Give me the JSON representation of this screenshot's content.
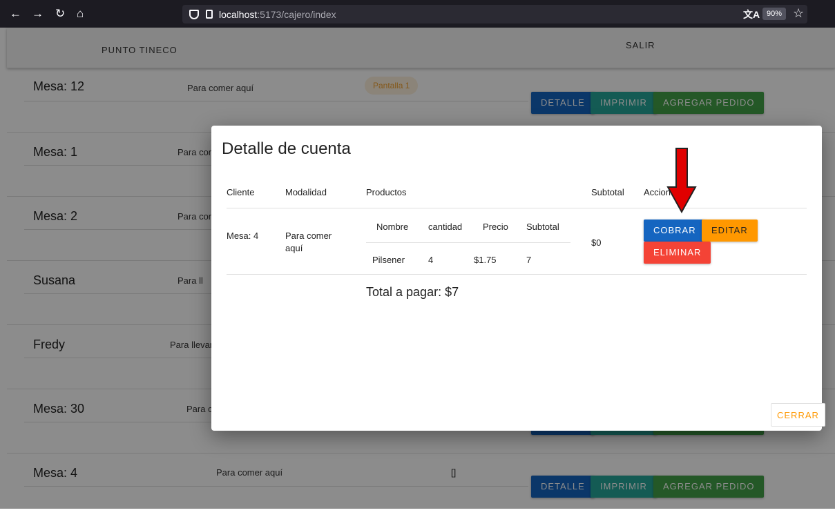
{
  "browser": {
    "url_host": "localhost",
    "url_path": ":5173/cajero/index",
    "zoom": "90%"
  },
  "header": {
    "brand": "PUNTO TINECO",
    "logout": "SALIR"
  },
  "orders": [
    {
      "mesa": "Mesa: 12",
      "modalidad": "Para comer aquí",
      "chip": "Pantalla 1"
    },
    {
      "mesa": "Mesa: 1",
      "modalidad": "Para com"
    },
    {
      "mesa": "Mesa: 2",
      "modalidad": "Para com"
    },
    {
      "mesa": "Susana",
      "modalidad": "Para ll"
    },
    {
      "mesa": "Fredy",
      "modalidad": "Para llevar"
    },
    {
      "mesa": "Mesa: 30",
      "modalidad": "Para c"
    },
    {
      "mesa": "Mesa: 4",
      "modalidad": "Para comer aquí",
      "bracket": "[]"
    }
  ],
  "row_buttons": {
    "detalle": "DETALLE",
    "imprimir": "IMPRIMIR",
    "agregar": "AGREGAR PEDIDO"
  },
  "modal": {
    "title": "Detalle de cuenta",
    "headers": {
      "cliente": "Cliente",
      "modalidad": "Modalidad",
      "productos": "Productos",
      "subtotal": "Subtotal",
      "acciones": "Acciones"
    },
    "row": {
      "cliente": "Mesa: 4",
      "modalidad": "Para comer aquí",
      "subtotal": "$0"
    },
    "products_headers": {
      "nombre": "Nombre",
      "cantidad": "cantidad",
      "precio": "Precio",
      "subtotal": "Subtotal"
    },
    "products": [
      {
        "nombre": "Pilsener",
        "cantidad": "4",
        "precio": "$1.75",
        "subtotal": "7"
      }
    ],
    "total": "Total a pagar: $7",
    "buttons": {
      "cobrar": "COBRAR",
      "editar": "EDITAR",
      "eliminar": "ELIMINAR",
      "cerrar": "CERRAR"
    }
  },
  "colors": {
    "primary": "#1565c0",
    "teal": "#26a69a",
    "green": "#43a047",
    "orange": "#ff9800",
    "red": "#f44336",
    "arrow": "#e00000"
  }
}
